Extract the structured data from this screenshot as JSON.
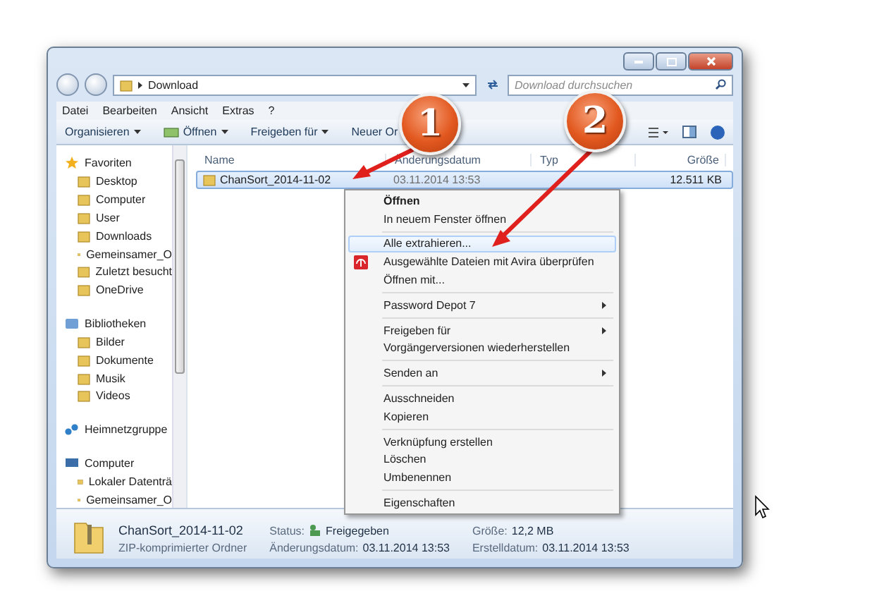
{
  "address": {
    "path": [
      "Download"
    ]
  },
  "search": {
    "placeholder": "Download durchsuchen"
  },
  "menu": [
    "Datei",
    "Bearbeiten",
    "Ansicht",
    "Extras",
    "?"
  ],
  "toolbar": [
    {
      "label": "Organisieren",
      "dropdown": true,
      "icon": false
    },
    {
      "label": "Öffnen",
      "dropdown": true,
      "icon": true
    },
    {
      "label": "Freigeben für",
      "dropdown": true,
      "icon": false
    },
    {
      "label": "Neuer Or",
      "dropdown": false,
      "icon": false
    }
  ],
  "sidebar": [
    {
      "label": "Favoriten",
      "children": [
        {
          "label": "Desktop"
        },
        {
          "label": "Computer"
        },
        {
          "label": "User"
        },
        {
          "label": "Downloads"
        },
        {
          "label": "Gemeinsamer_O"
        },
        {
          "label": "Zuletzt besucht"
        },
        {
          "label": "OneDrive"
        }
      ]
    },
    {
      "label": "Bibliotheken",
      "children": [
        {
          "label": "Bilder"
        },
        {
          "label": "Dokumente"
        },
        {
          "label": "Musik"
        },
        {
          "label": "Videos"
        }
      ]
    },
    {
      "label": "Heimnetzgruppe"
    },
    {
      "label": "Computer",
      "children": [
        {
          "label": "Lokaler Datenträ"
        },
        {
          "label": "Gemeinsamer_O"
        }
      ]
    }
  ],
  "columns": [
    "Name",
    "Änderungsdatum",
    "Typ",
    "Größe"
  ],
  "files": [
    {
      "name": "ChanSort_2014-11-02",
      "date": "03.11.2014 13:53",
      "size": "12.511 KB",
      "selected": true
    }
  ],
  "context_menu": [
    [
      {
        "label": "Öffnen",
        "kind": "default",
        "selected": false
      },
      {
        "label": "In neuem Fenster öffnen",
        "kind": "plain",
        "selected": false
      }
    ],
    [
      {
        "label": "Alle extrahieren...",
        "kind": "plain",
        "selected": true
      },
      {
        "label": "Ausgewählte Dateien mit Avira überprüfen",
        "kind": "antivirus",
        "selected": false
      },
      {
        "label": "Öffnen mit...",
        "kind": "plain",
        "selected": false
      }
    ],
    [
      {
        "label": "Password Depot 7",
        "kind": "submenu",
        "selected": false
      }
    ],
    [
      {
        "label": "Freigeben für",
        "kind": "submenu",
        "selected": false
      },
      {
        "label": "Vorgängerversionen wiederherstellen",
        "kind": "plain",
        "selected": false
      }
    ],
    [
      {
        "label": "Senden an",
        "kind": "submenu",
        "selected": false
      }
    ],
    [
      {
        "label": "Ausschneiden",
        "kind": "plain",
        "selected": false
      },
      {
        "label": "Kopieren",
        "kind": "plain",
        "selected": false
      }
    ],
    [
      {
        "label": "Verknüpfung erstellen",
        "kind": "plain",
        "selected": false
      },
      {
        "label": "Löschen",
        "kind": "plain",
        "selected": false
      },
      {
        "label": "Umbenennen",
        "kind": "plain",
        "selected": false
      }
    ],
    [
      {
        "label": "Eigenschaften",
        "kind": "plain",
        "selected": false
      }
    ]
  ],
  "callouts": [
    {
      "number": "1"
    },
    {
      "number": "2"
    }
  ],
  "details": {
    "name": "ChanSort_2014-11-02",
    "type": "ZIP-komprimierter Ordner",
    "status_label": "Status:",
    "status": "Freigegeben",
    "size_label": "Größe:",
    "size": "12,2 MB",
    "modified_label": "Änderungsdatum:",
    "modified": "03.11.2014 13:53",
    "created_label": "Erstelldatum:",
    "created": "03.11.2014 13:53"
  }
}
